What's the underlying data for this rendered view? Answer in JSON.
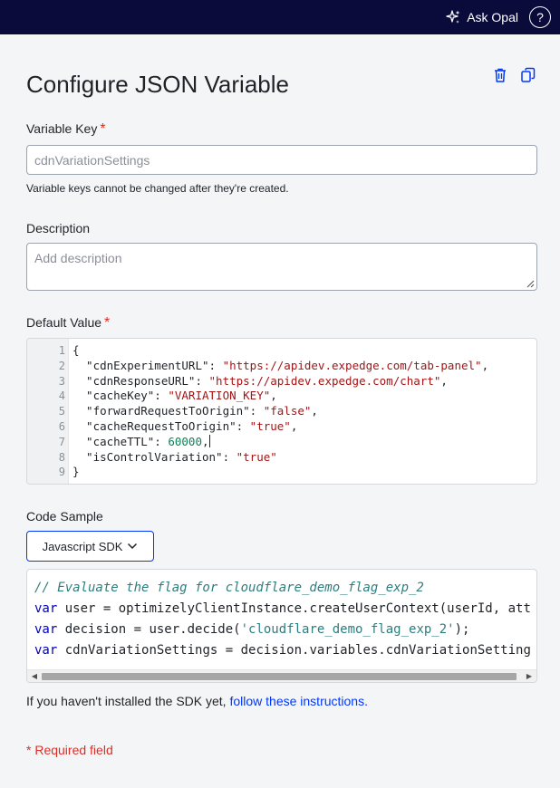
{
  "topbar": {
    "ask_opal_label": "Ask Opal",
    "help_label": "?"
  },
  "page": {
    "title": "Configure JSON Variable"
  },
  "variable_key": {
    "label": "Variable Key",
    "required_mark": "*",
    "value": "cdnVariationSettings",
    "helper": "Variable keys cannot be changed after they're created."
  },
  "description": {
    "label": "Description",
    "placeholder": "Add description"
  },
  "default_value": {
    "label": "Default Value",
    "required_mark": "*",
    "lines": [
      {
        "num": "1",
        "parts": [
          {
            "t": "p",
            "v": "{"
          }
        ]
      },
      {
        "num": "2",
        "parts": [
          {
            "t": "k",
            "v": "  \"cdnExperimentURL\": "
          },
          {
            "t": "s",
            "v": "\"https://apidev.expedge.com/tab-panel\""
          },
          {
            "t": "p",
            "v": ","
          }
        ]
      },
      {
        "num": "3",
        "parts": [
          {
            "t": "k",
            "v": "  \"cdnResponseURL\": "
          },
          {
            "t": "s",
            "v": "\"https://apidev.expedge.com/chart\""
          },
          {
            "t": "p",
            "v": ","
          }
        ]
      },
      {
        "num": "4",
        "parts": [
          {
            "t": "k",
            "v": "  \"cacheKey\": "
          },
          {
            "t": "s",
            "v": "\"VARIATION_KEY\""
          },
          {
            "t": "p",
            "v": ","
          }
        ]
      },
      {
        "num": "5",
        "parts": [
          {
            "t": "k",
            "v": "  \"forwardRequestToOrigin\": "
          },
          {
            "t": "s",
            "v": "\"false\""
          },
          {
            "t": "p",
            "v": ","
          }
        ]
      },
      {
        "num": "6",
        "parts": [
          {
            "t": "k",
            "v": "  \"cacheRequestToOrigin\": "
          },
          {
            "t": "s",
            "v": "\"true\""
          },
          {
            "t": "p",
            "v": ","
          }
        ]
      },
      {
        "num": "7",
        "parts": [
          {
            "t": "k",
            "v": "  \"cacheTTL\": "
          },
          {
            "t": "n",
            "v": "60000"
          },
          {
            "t": "p",
            "v": ","
          }
        ],
        "cursor": true
      },
      {
        "num": "8",
        "parts": [
          {
            "t": "k",
            "v": "  \"isControlVariation\": "
          },
          {
            "t": "s",
            "v": "\"true\""
          }
        ]
      },
      {
        "num": "9",
        "parts": [
          {
            "t": "p",
            "v": "}"
          }
        ]
      }
    ]
  },
  "code_sample": {
    "label": "Code Sample",
    "sdk_button_label": "Javascript SDK",
    "lines": [
      [
        {
          "t": "cm",
          "v": "// Evaluate the flag for cloudflare_demo_flag_exp_2"
        }
      ],
      [
        {
          "t": "kw",
          "v": "var"
        },
        {
          "t": "plain",
          "v": " user = optimizelyClientInstance.createUserContext(userId, att"
        }
      ],
      [
        {
          "t": "kw",
          "v": "var"
        },
        {
          "t": "plain",
          "v": " decision = user.decide("
        },
        {
          "t": "str",
          "v": "'cloudflare_demo_flag_exp_2'"
        },
        {
          "t": "plain",
          "v": ");"
        }
      ],
      [
        {
          "t": "kw",
          "v": "var"
        },
        {
          "t": "plain",
          "v": " cdnVariationSettings = decision.variables.cdnVariationSetting"
        }
      ]
    ]
  },
  "install_note": {
    "text": "If you haven't installed the SDK yet, ",
    "link": "follow these instructions."
  },
  "required_note": "* Required field",
  "colors": {
    "topbar_bg": "#0b0b3b",
    "accent_blue": "#0037ff",
    "required_red": "#d93025",
    "panel_bg": "#f4f5f7"
  },
  "icons": [
    "sparkle-icon",
    "help-icon",
    "trash-icon",
    "copy-icon",
    "chevron-down-icon",
    "resize-grip-icon"
  ]
}
